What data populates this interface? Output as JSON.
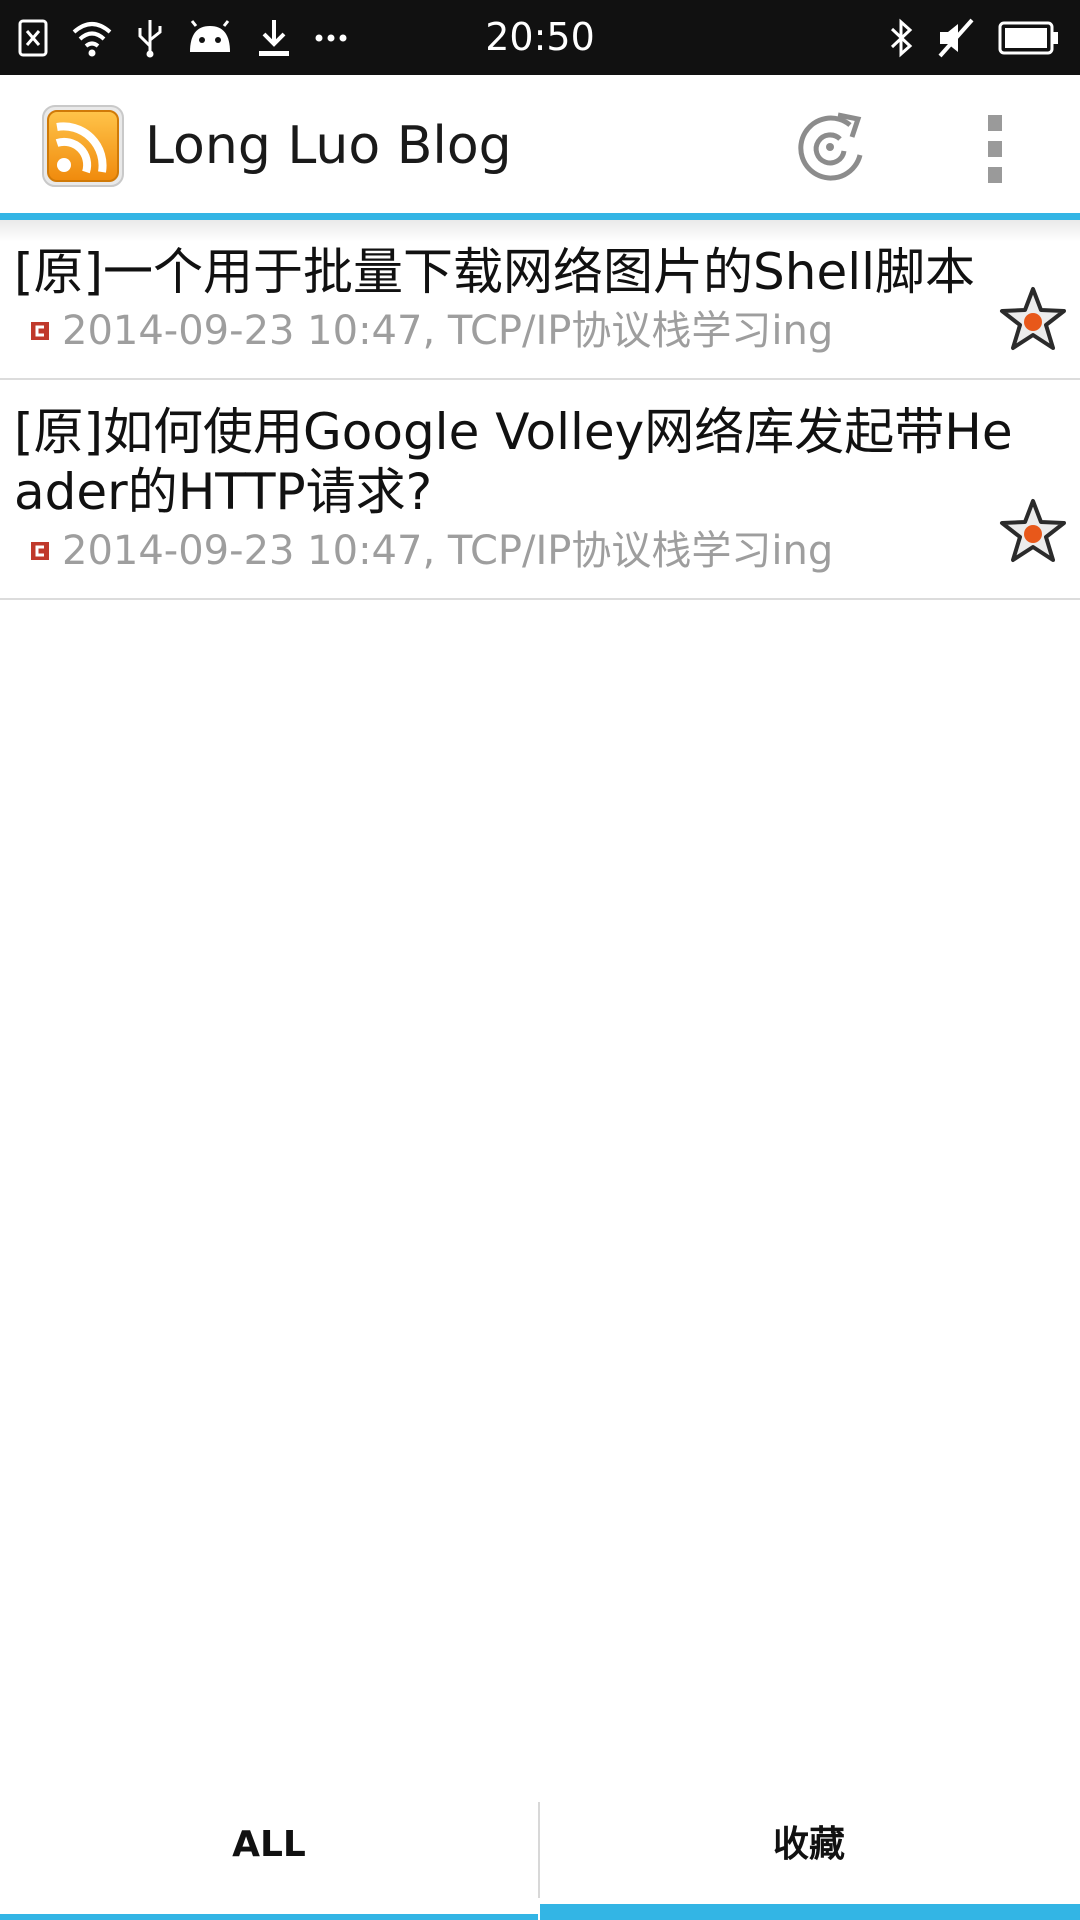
{
  "status_bar": {
    "time": "20:50",
    "icons_left": [
      "sim-error-icon",
      "wifi-icon",
      "usb-icon",
      "android-debug-icon",
      "download-icon",
      "more-notifications-icon"
    ],
    "icons_right": [
      "bluetooth-icon",
      "mute-icon",
      "battery-icon"
    ]
  },
  "action_bar": {
    "title": "Long Luo Blog",
    "app_icon": "rss-icon",
    "refresh_icon": "refresh-icon",
    "overflow_icon": "overflow-menu-icon"
  },
  "articles": [
    {
      "title": "[原]一个用于批量下载网络图片的Shell脚本",
      "meta": "2014-09-23 10:47, TCP/IP协议栈学习ing",
      "starred": true
    },
    {
      "title": "[原]如何使用Google Volley网络库发起带Header的HTTP请求?",
      "meta": "2014-09-23 10:47, TCP/IP协议栈学习ing",
      "starred": true
    }
  ],
  "tabs": [
    {
      "label": "ALL",
      "selected": false
    },
    {
      "label": "收藏",
      "selected": true
    }
  ],
  "colors": {
    "accent": "#33b5e5",
    "rss_orange": "#f7a21b",
    "star_dot": "#e8581a",
    "source_red": "#c0392b"
  }
}
